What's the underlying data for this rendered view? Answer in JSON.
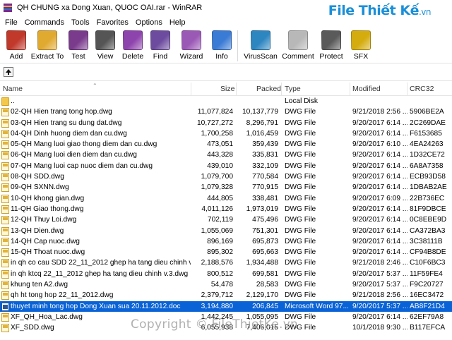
{
  "window": {
    "title": "QH CHUNG xa Dong Xuan, QUOC OAI.rar - WinRAR"
  },
  "watermark": {
    "logo_main": "File Thiết Kế",
    "logo_suffix": ".vn",
    "copyright": "Copyright © FileThietKe.vn"
  },
  "menu": [
    "File",
    "Commands",
    "Tools",
    "Favorites",
    "Options",
    "Help"
  ],
  "toolbar": [
    {
      "label": "Add",
      "icon": "add-archive-icon",
      "color": "#c0392b"
    },
    {
      "label": "Extract To",
      "icon": "extract-folder-icon",
      "color": "#e0a930"
    },
    {
      "label": "Test",
      "icon": "test-archive-icon",
      "color": "#7a3b8c"
    },
    {
      "label": "View",
      "icon": "view-glasses-icon",
      "color": "#555555"
    },
    {
      "label": "Delete",
      "icon": "delete-archive-icon",
      "color": "#8e44ad"
    },
    {
      "label": "Find",
      "icon": "find-magnifier-icon",
      "color": "#6d4c9f"
    },
    {
      "label": "Wizard",
      "icon": "wizard-wand-icon",
      "color": "#9b59b6"
    },
    {
      "label": "Info",
      "icon": "info-icon",
      "color": "#3a7bd5"
    },
    {
      "label": "VirusScan",
      "icon": "virus-scan-icon",
      "color": "#2e86c1"
    },
    {
      "label": "Comment",
      "icon": "comment-icon",
      "color": "#b8b8b8"
    },
    {
      "label": "Protect",
      "icon": "protect-shield-icon",
      "color": "#5a5a5a"
    },
    {
      "label": "SFX",
      "icon": "sfx-archive-icon",
      "color": "#d4ac0d"
    }
  ],
  "columns": {
    "name": "Name",
    "size": "Size",
    "packed": "Packed",
    "type": "Type",
    "modified": "Modified",
    "crc": "CRC32"
  },
  "files": [
    {
      "name": "..",
      "size": "",
      "packed": "",
      "type": "Local Disk",
      "modified": "",
      "crc": "",
      "kind": "folder"
    },
    {
      "name": "02-QH Hien trang tong hop.dwg",
      "size": "11,077,824",
      "packed": "10,137,779",
      "type": "DWG File",
      "modified": "9/21/2018 2:56 ...",
      "crc": "5906BE2A",
      "kind": "dwg"
    },
    {
      "name": "03-QH Hien trang su dung dat.dwg",
      "size": "10,727,272",
      "packed": "8,296,791",
      "type": "DWG File",
      "modified": "9/20/2017 6:14 ...",
      "crc": "2C269DAE",
      "kind": "dwg"
    },
    {
      "name": "04-QH Dinh huong diem dan cu.dwg",
      "size": "1,700,258",
      "packed": "1,016,459",
      "type": "DWG File",
      "modified": "9/20/2017 6:14 ...",
      "crc": "F6153685",
      "kind": "dwg"
    },
    {
      "name": "05-QH Mang luoi giao thong diem dan cu.dwg",
      "size": "473,051",
      "packed": "359,439",
      "type": "DWG File",
      "modified": "9/20/2017 6:10 ...",
      "crc": "4EA24263",
      "kind": "dwg"
    },
    {
      "name": "06-QH Mang luoi dien diem dan cu.dwg",
      "size": "443,328",
      "packed": "335,831",
      "type": "DWG File",
      "modified": "9/20/2017 6:14 ...",
      "crc": "1D32CE72",
      "kind": "dwg"
    },
    {
      "name": "07-QH Mang luoi cap nuoc diem dan cu.dwg",
      "size": "439,010",
      "packed": "332,109",
      "type": "DWG File",
      "modified": "9/20/2017 6:14 ...",
      "crc": "6A8A7358",
      "kind": "dwg"
    },
    {
      "name": "08-QH SDD.dwg",
      "size": "1,079,700",
      "packed": "770,584",
      "type": "DWG File",
      "modified": "9/20/2017 6:14 ...",
      "crc": "ECB93D58",
      "kind": "dwg"
    },
    {
      "name": "09-QH SXNN.dwg",
      "size": "1,079,328",
      "packed": "770,915",
      "type": "DWG File",
      "modified": "9/20/2017 6:14 ...",
      "crc": "1DBAB2AE",
      "kind": "dwg"
    },
    {
      "name": "10-QH khong gian.dwg",
      "size": "444,805",
      "packed": "338,481",
      "type": "DWG File",
      "modified": "9/20/2017 6:09 ...",
      "crc": "22B736EC",
      "kind": "dwg"
    },
    {
      "name": "11-QH Giao thong.dwg",
      "size": "4,011,126",
      "packed": "1,973,019",
      "type": "DWG File",
      "modified": "9/20/2017 6:14 ...",
      "crc": "81F9DBCE",
      "kind": "dwg"
    },
    {
      "name": "12-QH Thuy Loi.dwg",
      "size": "702,119",
      "packed": "475,496",
      "type": "DWG File",
      "modified": "9/20/2017 6:14 ...",
      "crc": "0C8EBE9D",
      "kind": "dwg"
    },
    {
      "name": "13-QH Dien.dwg",
      "size": "1,055,069",
      "packed": "751,301",
      "type": "DWG File",
      "modified": "9/20/2017 6:14 ...",
      "crc": "CA372BA3",
      "kind": "dwg"
    },
    {
      "name": "14-QH Cap nuoc.dwg",
      "size": "896,169",
      "packed": "695,873",
      "type": "DWG File",
      "modified": "9/20/2017 6:14 ...",
      "crc": "3C38111B",
      "kind": "dwg"
    },
    {
      "name": "15-QH Thoat nuoc.dwg",
      "size": "895,302",
      "packed": "695,663",
      "type": "DWG File",
      "modified": "9/20/2017 6:14 ...",
      "crc": "CF94B8DE",
      "kind": "dwg"
    },
    {
      "name": "in qh co cau SDD 22_11_2012 ghep ha tang dieu chinh v.3...",
      "size": "2,188,576",
      "packed": "1,934,488",
      "type": "DWG File",
      "modified": "9/21/2018 2:46 ...",
      "crc": "C10F6BC3",
      "kind": "dwg"
    },
    {
      "name": "in qh ktcq 22_11_2012 ghep ha tang dieu chinh v.3.dwg",
      "size": "800,512",
      "packed": "699,581",
      "type": "DWG File",
      "modified": "9/20/2017 5:37 ...",
      "crc": "11F59FE4",
      "kind": "dwg"
    },
    {
      "name": "khung ten A2.dwg",
      "size": "54,478",
      "packed": "28,583",
      "type": "DWG File",
      "modified": "9/20/2017 5:37 ...",
      "crc": "F9C20727",
      "kind": "dwg"
    },
    {
      "name": "qh ht tong hop 22_11_2012.dwg",
      "size": "2,379,712",
      "packed": "2,129,170",
      "type": "DWG File",
      "modified": "9/21/2018 2:56 ...",
      "crc": "16EC3472",
      "kind": "dwg"
    },
    {
      "name": "thuyet minh tong hop Dong Xuan sua 20.11.2012.doc",
      "size": "3,194,880",
      "packed": "206,845",
      "type": "Microsoft Word 97...",
      "modified": "9/20/2017 5:37 ...",
      "crc": "AB8F21D4",
      "kind": "doc",
      "selected": true
    },
    {
      "name": "XF_QH_Hoa_Lac.dwg",
      "size": "1,442,245",
      "packed": "1,055,095",
      "type": "DWG File",
      "modified": "9/20/2017 6:14 ...",
      "crc": "62EF79A8",
      "kind": "dwg"
    },
    {
      "name": "XF_SDD.dwg",
      "size": "6,055,938",
      "packed": "7,406,015",
      "type": "DWG File",
      "modified": "10/1/2018 9:30 ...",
      "crc": "B117EFCA",
      "kind": "dwg"
    }
  ]
}
